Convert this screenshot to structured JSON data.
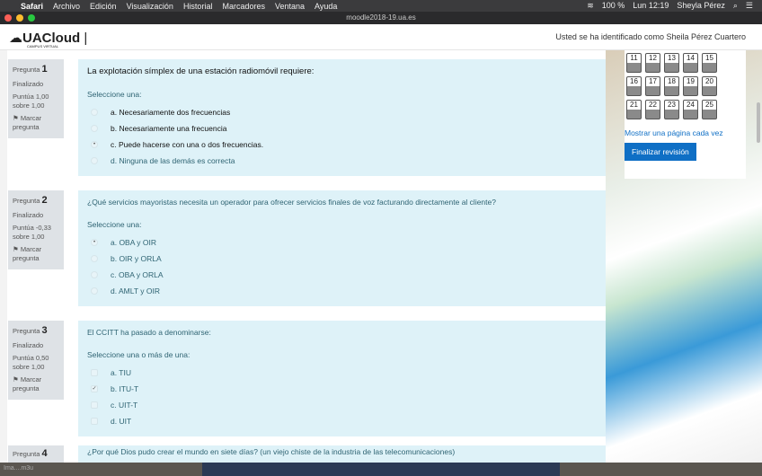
{
  "menubar": {
    "app": "Safari",
    "items": [
      "Archivo",
      "Edición",
      "Visualización",
      "Historial",
      "Marcadores",
      "Ventana",
      "Ayuda"
    ],
    "battery": "100 %",
    "time": "Lun 12:19",
    "user": "Sheyla Pérez"
  },
  "window": {
    "title": "moodle2018-19.ua.es"
  },
  "header": {
    "logo": "UACloud",
    "logo_sub": "CAMPUS VIRTUAL",
    "user_text": "Usted se ha identificado como Sheila Pérez Cuartero"
  },
  "questions": [
    {
      "label": "Pregunta",
      "num": "1",
      "state": "Finalizado",
      "score": "Puntúa 1,00 sobre 1,00",
      "flag": "Marcar pregunta",
      "text": "La explotación símplex de una estación radiomóvil requiere:",
      "prompt": "Seleccione una:",
      "options": [
        "a. Necesariamente dos frecuencias",
        "b. Necesariamente una frecuencia",
        "c. Puede hacerse con una o dos frecuencias.",
        "d. Ninguna de las demás es correcta"
      ]
    },
    {
      "label": "Pregunta",
      "num": "2",
      "state": "Finalizado",
      "score": "Puntúa -0,33 sobre 1,00",
      "flag": "Marcar pregunta",
      "text": "¿Qué servicios mayoristas necesita un operador para ofrecer servicios finales de voz facturando directamente al cliente?",
      "prompt": "Seleccione una:",
      "options": [
        "a. OBA y OIR",
        "b. OIR y ORLA",
        "c. OBA y ORLA",
        "d. AMLT y OIR"
      ]
    },
    {
      "label": "Pregunta",
      "num": "3",
      "state": "Finalizado",
      "score": "Puntúa 0,50 sobre 1,00",
      "flag": "Marcar pregunta",
      "text": "El CCITT ha pasado a denominarse:",
      "prompt": "Seleccione una o más de una:",
      "options": [
        "a. TIU",
        "b. ITU-T",
        "c. UIT-T",
        "d. UIT"
      ]
    },
    {
      "label": "Pregunta",
      "num": "4",
      "text": "¿Por qué Dios pudo crear el mundo en siete días? (un viejo chiste de la industria de las telecomunicaciones)"
    }
  ],
  "nav": {
    "cells": [
      "11",
      "12",
      "13",
      "14",
      "15",
      "16",
      "17",
      "18",
      "19",
      "20",
      "21",
      "22",
      "23",
      "24",
      "25"
    ],
    "show_one_page": "Mostrar una página cada vez",
    "finish": "Finalizar revisión"
  },
  "dock": {
    "label": "Ima....m3u"
  }
}
